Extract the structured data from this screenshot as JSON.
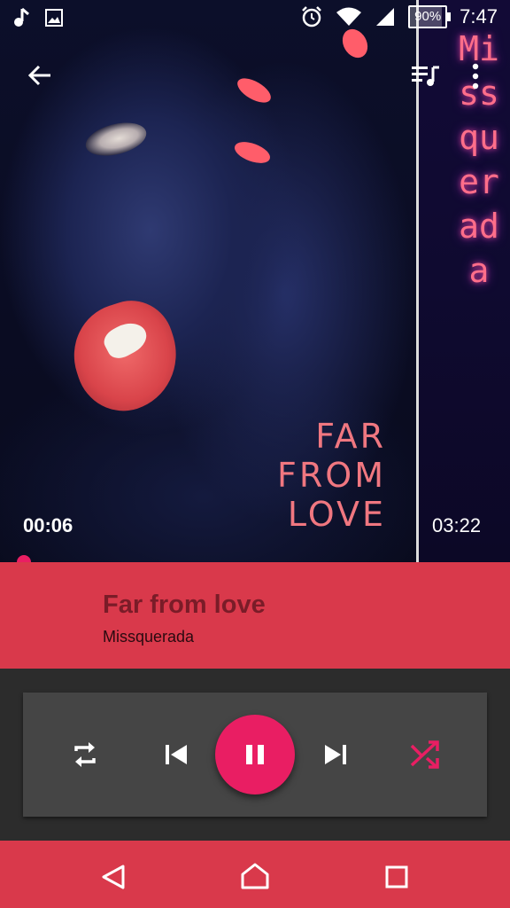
{
  "status_bar": {
    "battery": "90%",
    "time": "7:47"
  },
  "album_art": {
    "cover_title_lines": [
      "FAR",
      "FROM",
      "LOVE"
    ],
    "vertical_artist": "Missquerada"
  },
  "playback": {
    "elapsed": "00:06",
    "duration": "03:22",
    "progress": 0.03
  },
  "track": {
    "title": "Far from love",
    "artist": "Missquerada"
  },
  "controls": {
    "repeat": "repeat-icon",
    "previous": "skip-previous-icon",
    "play_pause": "pause-icon",
    "next": "skip-next-icon",
    "shuffle": "shuffle-icon"
  },
  "nav": {
    "back": "back-triangle-icon",
    "home": "home-icon",
    "recents": "recents-square-icon"
  },
  "colors": {
    "accent": "#e91e63",
    "track_bar": "#d9394b",
    "title_text": "#7a1c28",
    "shuffle_active": "#e91e63"
  }
}
